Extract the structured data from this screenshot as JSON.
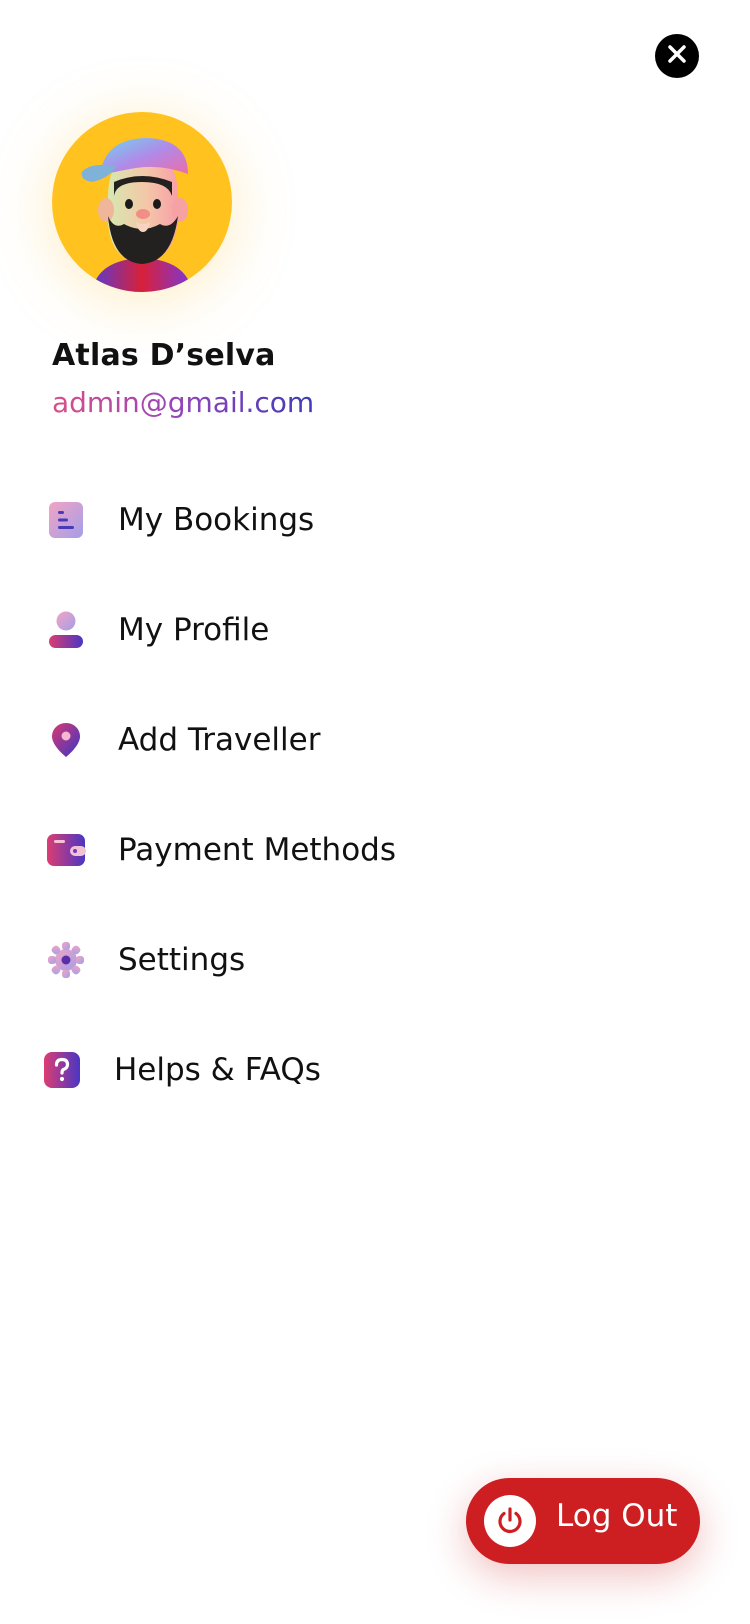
{
  "header": {
    "close_icon": "close-icon"
  },
  "profile": {
    "name": "Atlas D’selva",
    "email": "admin@gmail.com",
    "avatar_icon": "avatar"
  },
  "menu": {
    "items": [
      {
        "label": "My Bookings",
        "icon": "bookings-icon"
      },
      {
        "label": "My Profile",
        "icon": "user-icon"
      },
      {
        "label": "Add Traveller",
        "icon": "location-pin-icon"
      },
      {
        "label": "Payment Methods",
        "icon": "wallet-icon"
      },
      {
        "label": "Settings",
        "icon": "gear-icon"
      },
      {
        "label": "Helps & FAQs",
        "icon": "help-icon"
      }
    ]
  },
  "logout": {
    "label": "Log Out",
    "icon": "power-icon"
  },
  "colors": {
    "accent_gradient_start": "#d94f86",
    "accent_gradient_end": "#3d3bb8",
    "logout_red": "#cd1f22",
    "avatar_bg": "#ffc21f"
  }
}
